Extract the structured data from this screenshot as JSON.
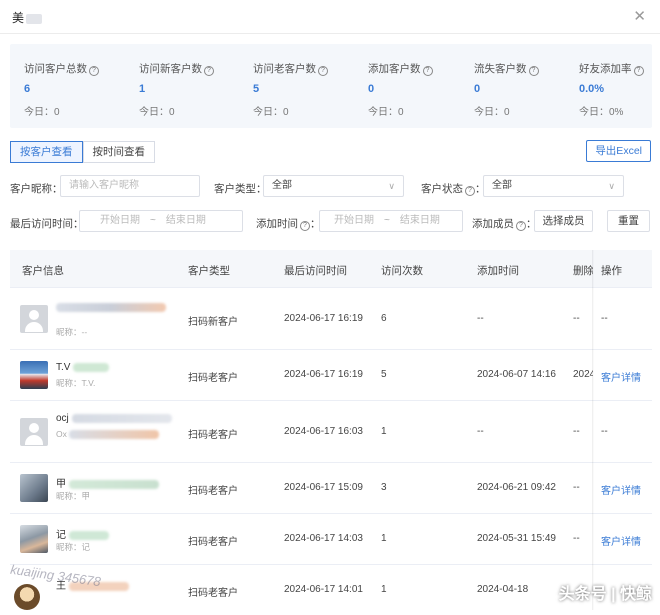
{
  "window": {
    "title": "美",
    "close_icon": "close-icon"
  },
  "stats": [
    {
      "label": "访问客户总数",
      "value": "6",
      "today": "今日：0"
    },
    {
      "label": "访问新客户数",
      "value": "1",
      "today": "今日：0"
    },
    {
      "label": "访问老客户数",
      "value": "5",
      "today": "今日：0"
    },
    {
      "label": "添加客户数",
      "value": "0",
      "today": "今日：0"
    },
    {
      "label": "流失客户数",
      "value": "0",
      "today": "今日：0"
    },
    {
      "label": "好友添加率",
      "value": "0.0%",
      "today": "今日：0%"
    }
  ],
  "tabs": [
    {
      "label": "按客户查看",
      "active": true
    },
    {
      "label": "按时间查看",
      "active": false
    }
  ],
  "export_label": "导出Excel",
  "filters": {
    "nickname_label": "客户昵称：",
    "nickname_placeholder": "请输入客户昵称",
    "type_label": "客户类型：",
    "type_value": "全部",
    "status_label": "客户状态",
    "status_value": "全部",
    "last_visit_label": "最后访问时间：",
    "added_time_label": "添加时间",
    "start_date": "开始日期",
    "end_date": "结束日期",
    "range_sep": "~",
    "added_member_label": "添加成员",
    "select_member_label": "选择成员",
    "reset_label": "重置"
  },
  "table": {
    "headers": [
      "客户信息",
      "客户类型",
      "最后访问时间",
      "访问次数",
      "添加时间",
      "删除",
      "操作"
    ],
    "rows": [
      {
        "name": "",
        "sub": "昵称：--",
        "type": "扫码新客户",
        "last_visit": "2024-06-17 16:19",
        "visits": "6",
        "added": "--",
        "deleted": "--",
        "action": "--"
      },
      {
        "name": "T.V",
        "sub": "昵称：T.V.",
        "type": "扫码老客户",
        "last_visit": "2024-06-17 16:19",
        "visits": "5",
        "added": "2024-06-07 14:16",
        "deleted": "2024",
        "action": "客户详情"
      },
      {
        "name": "ocj",
        "sub": "",
        "type": "扫码老客户",
        "last_visit": "2024-06-17 16:03",
        "visits": "1",
        "added": "--",
        "deleted": "--",
        "action": "--"
      },
      {
        "name": "甲",
        "sub": "昵称：甲",
        "type": "扫码老客户",
        "last_visit": "2024-06-17 15:09",
        "visits": "3",
        "added": "2024-06-21 09:42",
        "deleted": "--",
        "action": "客户详情"
      },
      {
        "name": "记",
        "sub": "昵称：记",
        "type": "扫码老客户",
        "last_visit": "2024-06-17 14:03",
        "visits": "1",
        "added": "2024-05-31 15:49",
        "deleted": "--",
        "action": "客户详情"
      },
      {
        "name": "王",
        "sub": "",
        "type": "扫码老客户",
        "last_visit": "2024-06-17 14:01",
        "visits": "1",
        "added": "2024-04-18",
        "deleted": "",
        "action": ""
      }
    ]
  },
  "watermarks": {
    "handle": "kuaijing 345678",
    "brand": "头条号 | 快鲸"
  },
  "colors": {
    "accent": "#3a7bd5",
    "stats_bg": "#f4f7fb",
    "header_bg": "#f5f7fa"
  }
}
